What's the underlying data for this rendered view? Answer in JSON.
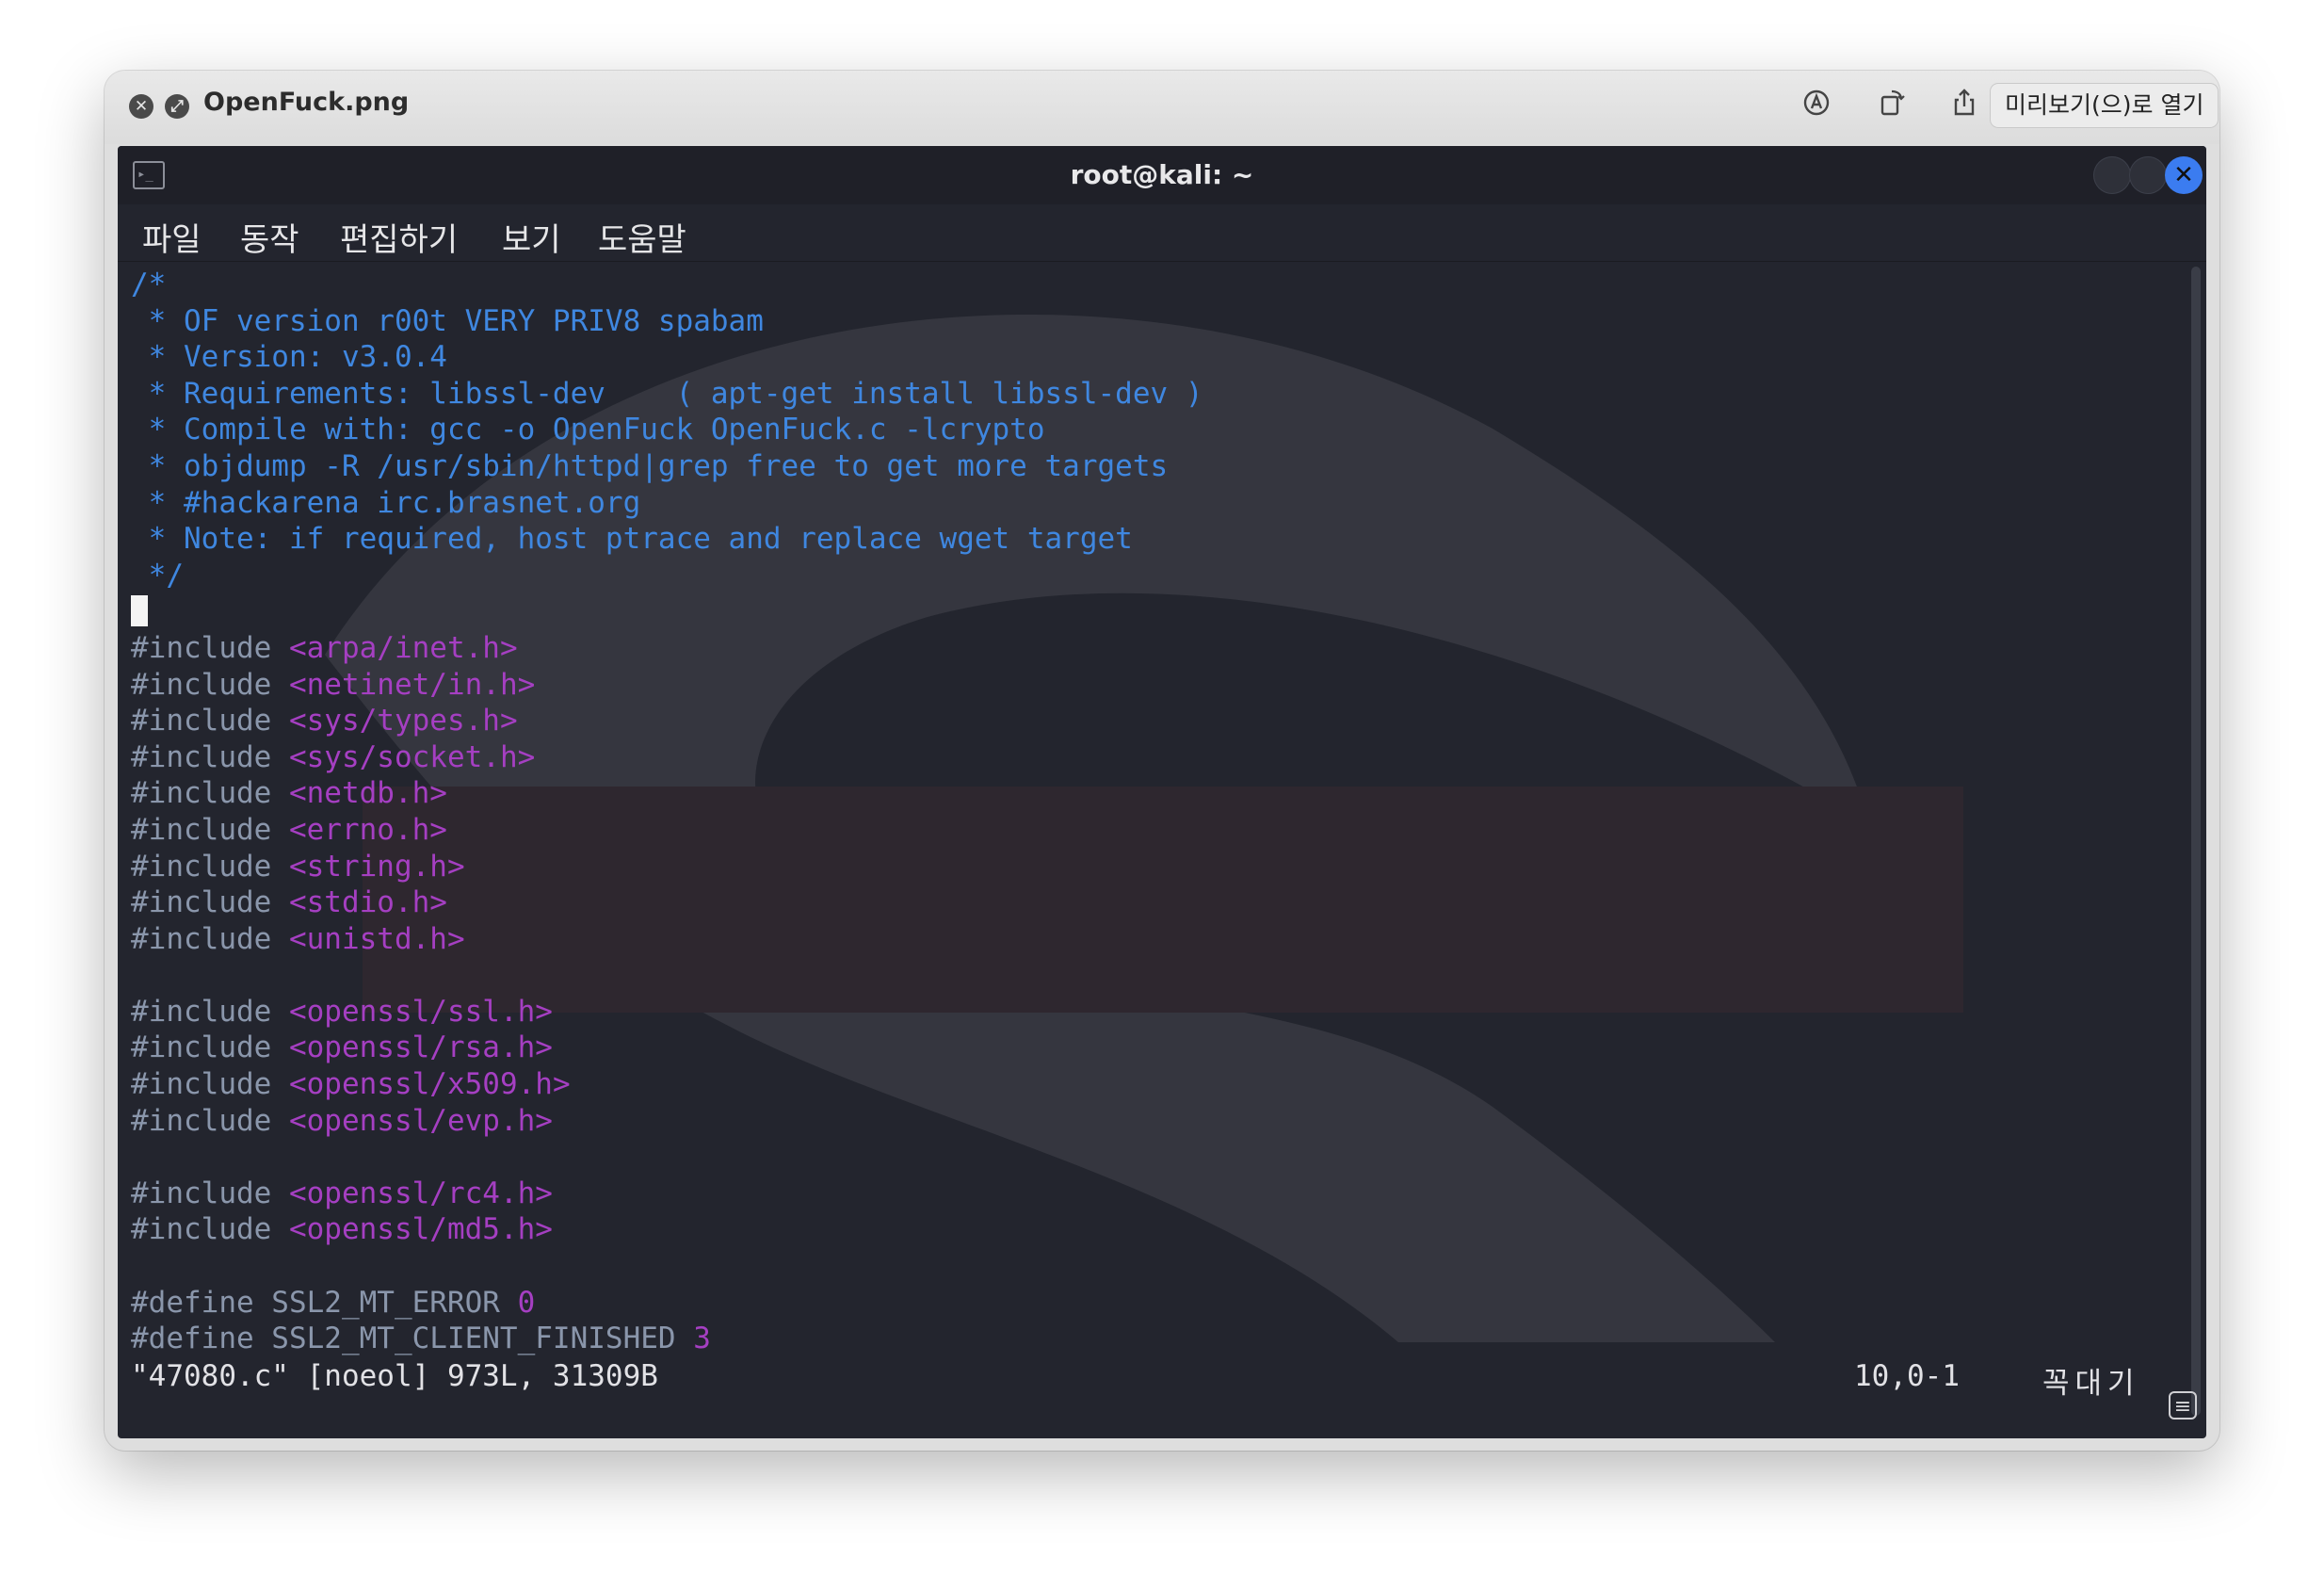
{
  "quicklook": {
    "filename": "OpenFuck.png",
    "open_button_label": "미리보기(으)로 열기",
    "icons": [
      "close-icon",
      "fullscreen-icon",
      "markup-icon",
      "rotate-icon",
      "share-icon"
    ]
  },
  "terminal": {
    "title": "root@kali: ~",
    "menu": [
      "파일",
      "동작",
      "편집하기",
      "보기",
      "도움말"
    ],
    "code_lines": [
      [
        {
          "t": "/*",
          "c": "cm"
        }
      ],
      [
        {
          "t": " * OF version r00t VERY PRIV8 spabam",
          "c": "cm"
        }
      ],
      [
        {
          "t": " * Version: v3.0.4",
          "c": "cm"
        }
      ],
      [
        {
          "t": " * Requirements: libssl-dev    ( apt-get install libssl-dev )",
          "c": "cm"
        }
      ],
      [
        {
          "t": " * Compile with: gcc -o OpenFuck OpenFuck.c -lcrypto",
          "c": "cm"
        }
      ],
      [
        {
          "t": " * objdump -R /usr/sbin/httpd|grep free to get more targets",
          "c": "cm"
        }
      ],
      [
        {
          "t": " * #hackarena irc.brasnet.org",
          "c": "cm"
        }
      ],
      [
        {
          "t": " * Note: if required, host ptrace and replace wget target",
          "c": "cm"
        }
      ],
      [
        {
          "t": " */",
          "c": "cm"
        }
      ],
      [
        {
          "t": "",
          "c": "cursor"
        }
      ],
      [
        {
          "t": "#include ",
          "c": "pp"
        },
        {
          "t": "<arpa/inet.h>",
          "c": "hd"
        }
      ],
      [
        {
          "t": "#include ",
          "c": "pp"
        },
        {
          "t": "<netinet/in.h>",
          "c": "hd"
        }
      ],
      [
        {
          "t": "#include ",
          "c": "pp"
        },
        {
          "t": "<sys/types.h>",
          "c": "hd"
        }
      ],
      [
        {
          "t": "#include ",
          "c": "pp"
        },
        {
          "t": "<sys/socket.h>",
          "c": "hd"
        }
      ],
      [
        {
          "t": "#include ",
          "c": "pp"
        },
        {
          "t": "<netdb.h>",
          "c": "hd"
        }
      ],
      [
        {
          "t": "#include ",
          "c": "pp"
        },
        {
          "t": "<errno.h>",
          "c": "hd"
        }
      ],
      [
        {
          "t": "#include ",
          "c": "pp"
        },
        {
          "t": "<string.h>",
          "c": "hd"
        }
      ],
      [
        {
          "t": "#include ",
          "c": "pp"
        },
        {
          "t": "<stdio.h>",
          "c": "hd"
        }
      ],
      [
        {
          "t": "#include ",
          "c": "pp"
        },
        {
          "t": "<unistd.h>",
          "c": "hd"
        }
      ],
      [],
      [
        {
          "t": "#include ",
          "c": "pp"
        },
        {
          "t": "<openssl/ssl.h>",
          "c": "hd"
        }
      ],
      [
        {
          "t": "#include ",
          "c": "pp"
        },
        {
          "t": "<openssl/rsa.h>",
          "c": "hd"
        }
      ],
      [
        {
          "t": "#include ",
          "c": "pp"
        },
        {
          "t": "<openssl/x509.h>",
          "c": "hd"
        }
      ],
      [
        {
          "t": "#include ",
          "c": "pp"
        },
        {
          "t": "<openssl/evp.h>",
          "c": "hd"
        }
      ],
      [],
      [
        {
          "t": "#include ",
          "c": "pp"
        },
        {
          "t": "<openssl/rc4.h>",
          "c": "hd"
        }
      ],
      [
        {
          "t": "#include ",
          "c": "pp"
        },
        {
          "t": "<openssl/md5.h>",
          "c": "hd"
        }
      ],
      [],
      [
        {
          "t": "#define SSL2_MT_ERROR ",
          "c": "pp"
        },
        {
          "t": "0",
          "c": "nm"
        }
      ],
      [
        {
          "t": "#define SSL2_MT_CLIENT_FINISHED ",
          "c": "pp"
        },
        {
          "t": "3",
          "c": "nm"
        }
      ]
    ],
    "status_line": "\"47080.c\" [noeol] 973L, 31309B",
    "cursor_position": "10,0-1",
    "scroll_position": "꼭대기"
  },
  "colors": {
    "comment": "#3f87e0",
    "preprocessor": "#8a96ab",
    "header": "#a53fc2",
    "background": "#23252e",
    "close_button": "#3b7cf0"
  }
}
